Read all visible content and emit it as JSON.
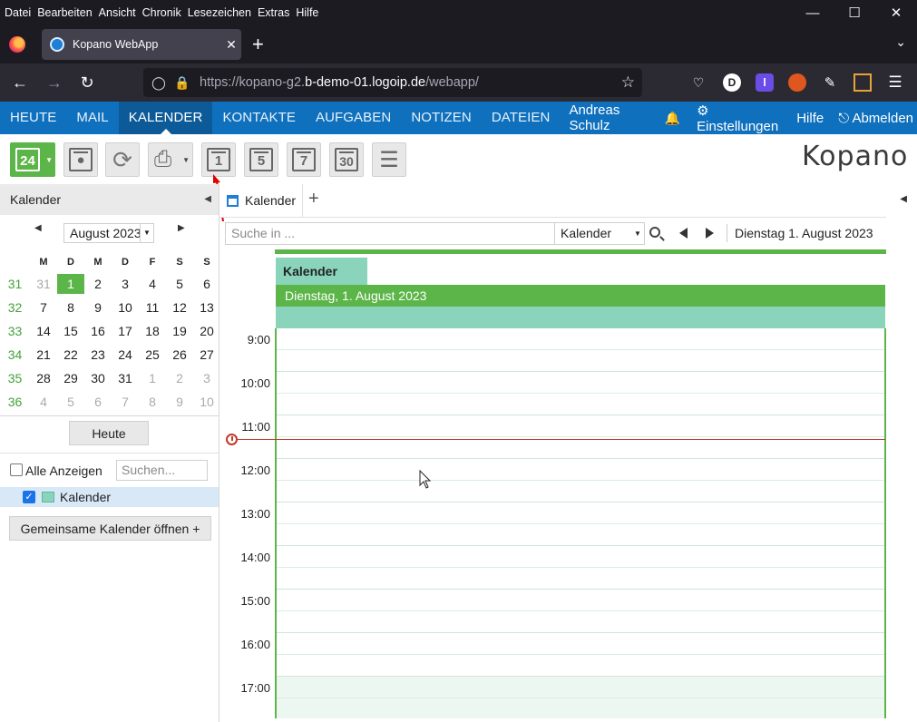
{
  "browser": {
    "menu": [
      "Datei",
      "Bearbeiten",
      "Ansicht",
      "Chronik",
      "Lesezeichen",
      "Extras",
      "Hilfe"
    ],
    "tab_title": "Kopano WebApp",
    "url_dim_prefix": "https://kopano-g2.",
    "url_host": "b-demo-01.logoip.de",
    "url_dim_suffix": "/webapp/",
    "ext_d_label": "D",
    "ext_l_label": "l"
  },
  "nav": {
    "items": [
      "HEUTE",
      "MAIL",
      "KALENDER",
      "KONTAKTE",
      "AUFGABEN",
      "NOTIZEN",
      "DATEIEN"
    ],
    "user": "Andreas Schulz",
    "settings": "Einstellungen",
    "help": "Hilfe",
    "logout": "Abmelden"
  },
  "toolbar": {
    "today_num": "24",
    "day_view": "1",
    "workweek_view": "5",
    "week_view": "7",
    "month_view": "30",
    "logo": "Kopano"
  },
  "left": {
    "title": "Kalender",
    "month": "August 2023",
    "weekday_headers": [
      "M",
      "D",
      "M",
      "D",
      "F",
      "S",
      "S"
    ],
    "weeks": [
      {
        "wk": "31",
        "days": [
          "31",
          "1",
          "2",
          "3",
          "4",
          "5",
          "6"
        ]
      },
      {
        "wk": "32",
        "days": [
          "7",
          "8",
          "9",
          "10",
          "11",
          "12",
          "13"
        ]
      },
      {
        "wk": "33",
        "days": [
          "14",
          "15",
          "16",
          "17",
          "18",
          "19",
          "20"
        ]
      },
      {
        "wk": "34",
        "days": [
          "21",
          "22",
          "23",
          "24",
          "25",
          "26",
          "27"
        ]
      },
      {
        "wk": "35",
        "days": [
          "28",
          "29",
          "30",
          "31",
          "1",
          "2",
          "3"
        ]
      },
      {
        "wk": "36",
        "days": [
          "4",
          "5",
          "6",
          "7",
          "8",
          "9",
          "10"
        ]
      }
    ],
    "today_button": "Heute",
    "show_all": "Alle Anzeigen",
    "search_placeholder": "Suchen...",
    "calendar_item": "Kalender",
    "shared_button": "Gemeinsame Kalender öffnen +"
  },
  "main": {
    "tab": "Kalender",
    "search_placeholder": "Suche in ...",
    "scope": "Kalender",
    "date_label": "Dienstag 1. August 2023",
    "calendar_chip": "Kalender",
    "day_header": "Dienstag, 1. August 2023",
    "hours": [
      "9:00",
      "10:00",
      "11:00",
      "12:00",
      "13:00",
      "14:00",
      "15:00",
      "16:00",
      "17:00"
    ]
  },
  "colors": {
    "kopano_blue": "#0f70bd",
    "green": "#5cb548",
    "mint": "#8ad4bb"
  }
}
